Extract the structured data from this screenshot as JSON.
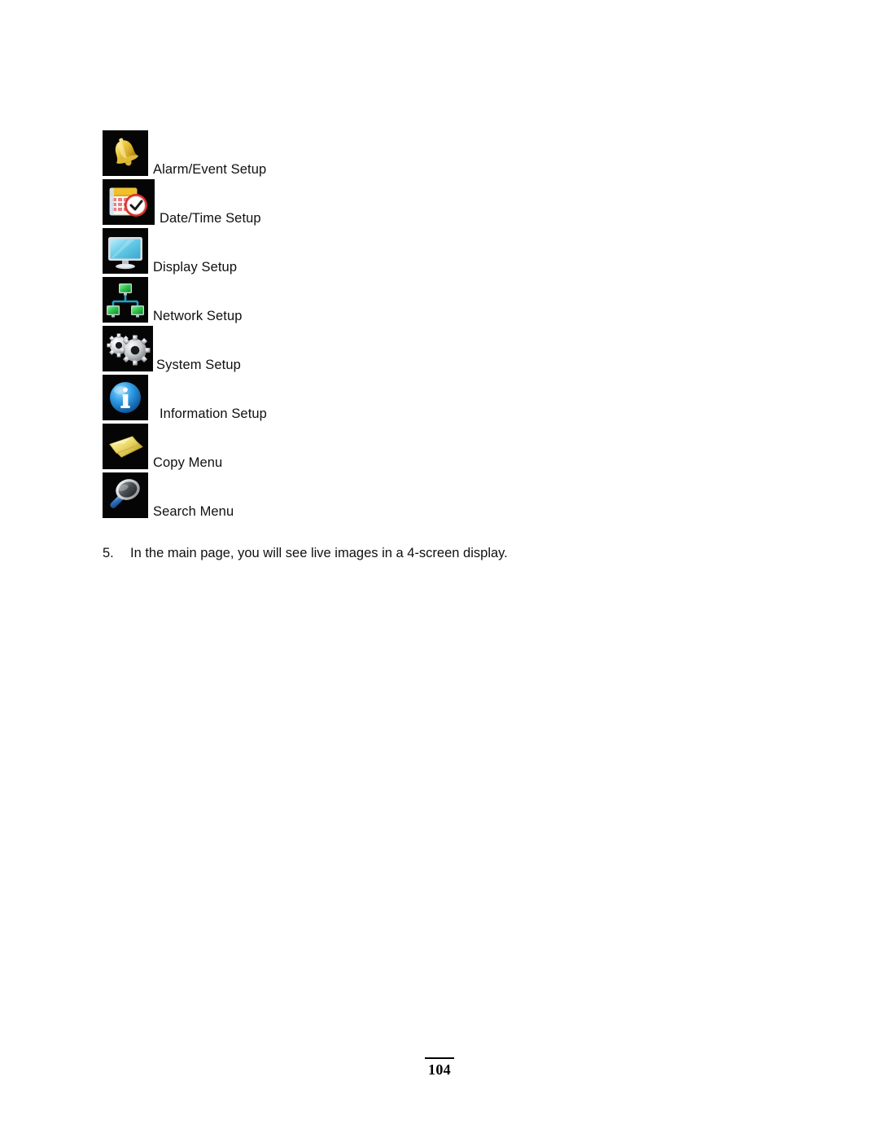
{
  "document": {
    "type": "user-manual-page",
    "page_number": "104"
  },
  "menu": {
    "items": [
      {
        "icon": "bell-icon",
        "label": "Alarm/Event Setup"
      },
      {
        "icon": "calendar-clock-icon",
        "label": "Date/Time Setup"
      },
      {
        "icon": "monitor-icon",
        "label": "Display Setup"
      },
      {
        "icon": "network-icon",
        "label": "Network Setup"
      },
      {
        "icon": "gears-icon",
        "label": "System Setup"
      },
      {
        "icon": "information-icon",
        "label": "Information Setup"
      },
      {
        "icon": "copy-pages-icon",
        "label": "Copy Menu"
      },
      {
        "icon": "magnifier-icon",
        "label": "Search Menu"
      }
    ]
  },
  "step": {
    "number": "5.",
    "text": "In the main page, you will see live images in a 4-screen display."
  },
  "footer": {
    "page_number": "104"
  },
  "colors": {
    "icon_background": "#050505",
    "text": "#101010",
    "page_background": "#ffffff"
  }
}
